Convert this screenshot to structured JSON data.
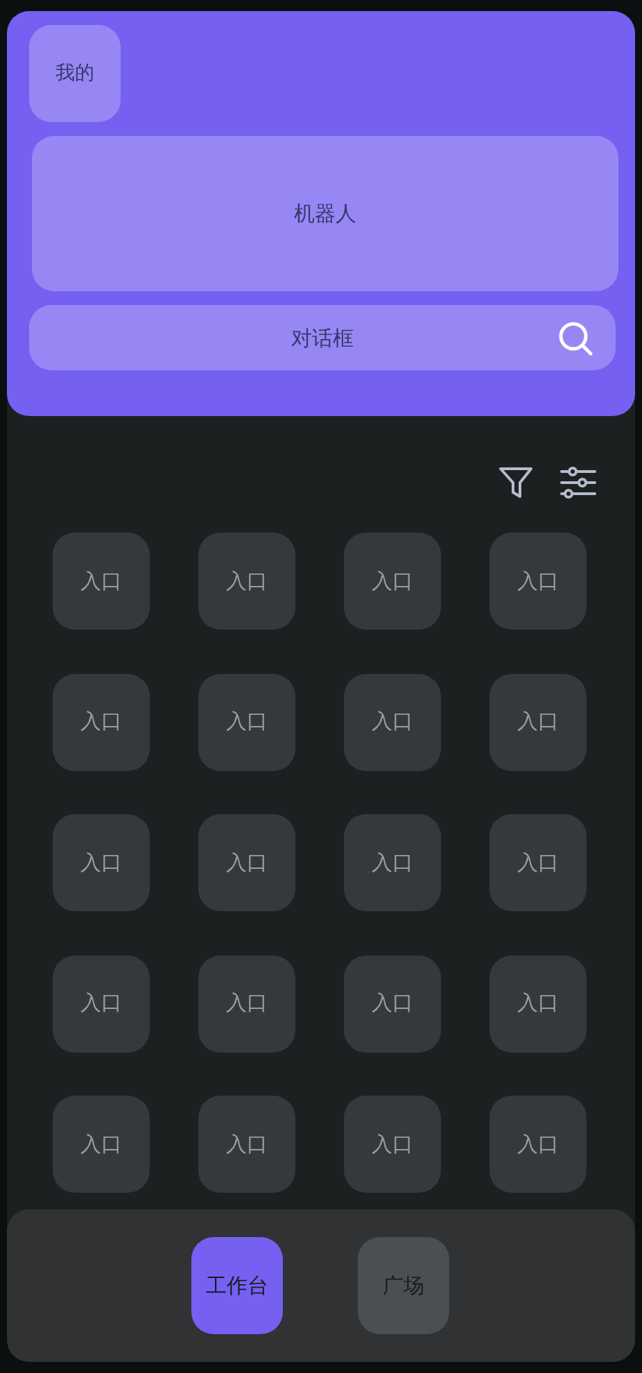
{
  "header": {
    "profile_button": "我的",
    "robot_card": "机器人",
    "chat_field": {
      "placeholder": "对话框"
    }
  },
  "entries": [
    {
      "label": "入口"
    },
    {
      "label": "入口"
    },
    {
      "label": "入口"
    },
    {
      "label": "入口"
    },
    {
      "label": "入口"
    },
    {
      "label": "入口"
    },
    {
      "label": "入口"
    },
    {
      "label": "入口"
    },
    {
      "label": "入口"
    },
    {
      "label": "入口"
    },
    {
      "label": "入口"
    },
    {
      "label": "入口"
    },
    {
      "label": "入口"
    },
    {
      "label": "入口"
    },
    {
      "label": "入口"
    },
    {
      "label": "入口"
    },
    {
      "label": "入口"
    },
    {
      "label": "入口"
    },
    {
      "label": "入口"
    },
    {
      "label": "入口"
    }
  ],
  "bottom_nav": [
    {
      "label": "工作台",
      "selected": true
    },
    {
      "label": "广场",
      "selected": false
    }
  ]
}
